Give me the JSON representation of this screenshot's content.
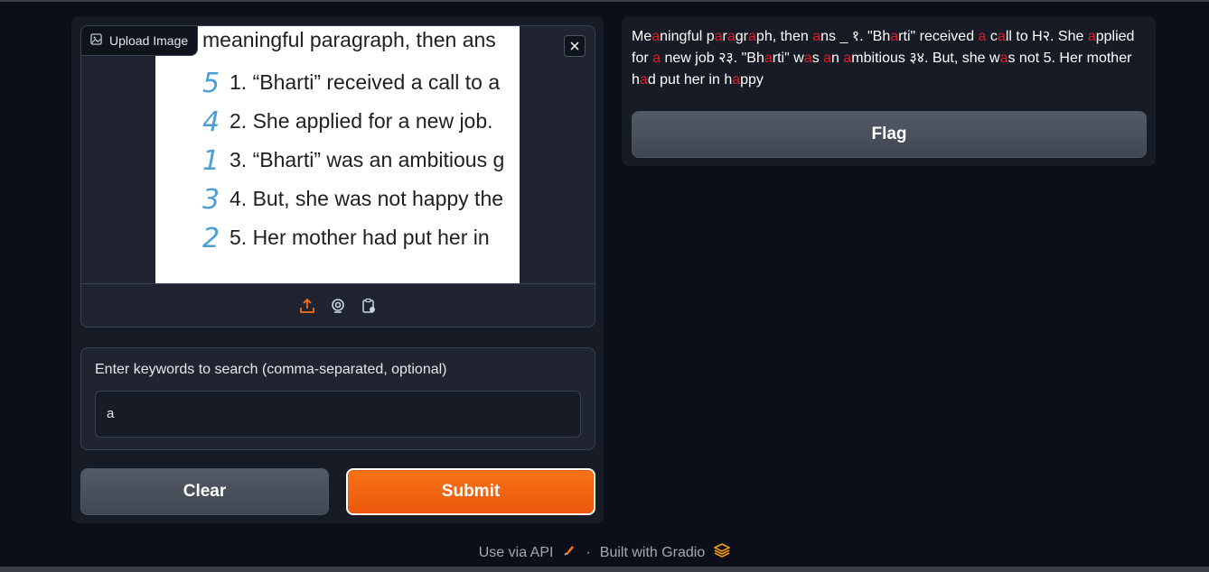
{
  "image_input": {
    "label": "Upload Image",
    "icon": "image-icon",
    "close_icon": "close-icon",
    "preview": {
      "heading": "meaningful paragraph, then ans",
      "lines": [
        {
          "mark": "5",
          "text": "1. “Bharti” received a call to a"
        },
        {
          "mark": "4",
          "text": "2. She applied for a new job."
        },
        {
          "mark": "1",
          "text": "3. “Bharti” was an ambitious g"
        },
        {
          "mark": "3",
          "text": "4. But, she was not happy the"
        },
        {
          "mark": "2",
          "text": "5. Her mother had put her in"
        }
      ]
    },
    "toolbar": [
      "upload-icon",
      "webcam-icon",
      "clipboard-icon"
    ],
    "toolbar_color_active": "#f97316"
  },
  "keywords": {
    "label": "Enter keywords to search (comma-separated, optional)",
    "value": "a"
  },
  "buttons": {
    "clear": "Clear",
    "submit": "Submit",
    "flag": "Flag"
  },
  "output": {
    "highlight_color": "#e11d2a",
    "segments": [
      {
        "t": "Me",
        "h": false
      },
      {
        "t": "a",
        "h": true
      },
      {
        "t": "ningful p",
        "h": false
      },
      {
        "t": "a",
        "h": true
      },
      {
        "t": "r",
        "h": false
      },
      {
        "t": "a",
        "h": true
      },
      {
        "t": "gr",
        "h": false
      },
      {
        "t": "a",
        "h": true
      },
      {
        "t": "ph, then ",
        "h": false
      },
      {
        "t": "a",
        "h": true
      },
      {
        "t": "ns _ १. \"Bh",
        "h": false
      },
      {
        "t": "a",
        "h": true
      },
      {
        "t": "rti\" received ",
        "h": false
      },
      {
        "t": "a",
        "h": true
      },
      {
        "t": " c",
        "h": false
      },
      {
        "t": "a",
        "h": true
      },
      {
        "t": "ll to H२. She ",
        "h": false
      },
      {
        "t": "a",
        "h": true
      },
      {
        "t": "pplied for ",
        "h": false
      },
      {
        "t": "a",
        "h": true
      },
      {
        "t": " new job २३. \"Bh",
        "h": false
      },
      {
        "t": "a",
        "h": true
      },
      {
        "t": "rti\" w",
        "h": false
      },
      {
        "t": "a",
        "h": true
      },
      {
        "t": "s ",
        "h": false
      },
      {
        "t": "a",
        "h": true
      },
      {
        "t": "n ",
        "h": false
      },
      {
        "t": "a",
        "h": true
      },
      {
        "t": "mbitious ३४. But, she w",
        "h": false
      },
      {
        "t": "a",
        "h": true
      },
      {
        "t": "s not 5. Her mother h",
        "h": false
      },
      {
        "t": "a",
        "h": true
      },
      {
        "t": "d put her in h",
        "h": false
      },
      {
        "t": "a",
        "h": true
      },
      {
        "t": "ppy",
        "h": false
      }
    ]
  },
  "footer": {
    "api": "Use via API",
    "separator": "·",
    "built": "Built with Gradio"
  }
}
